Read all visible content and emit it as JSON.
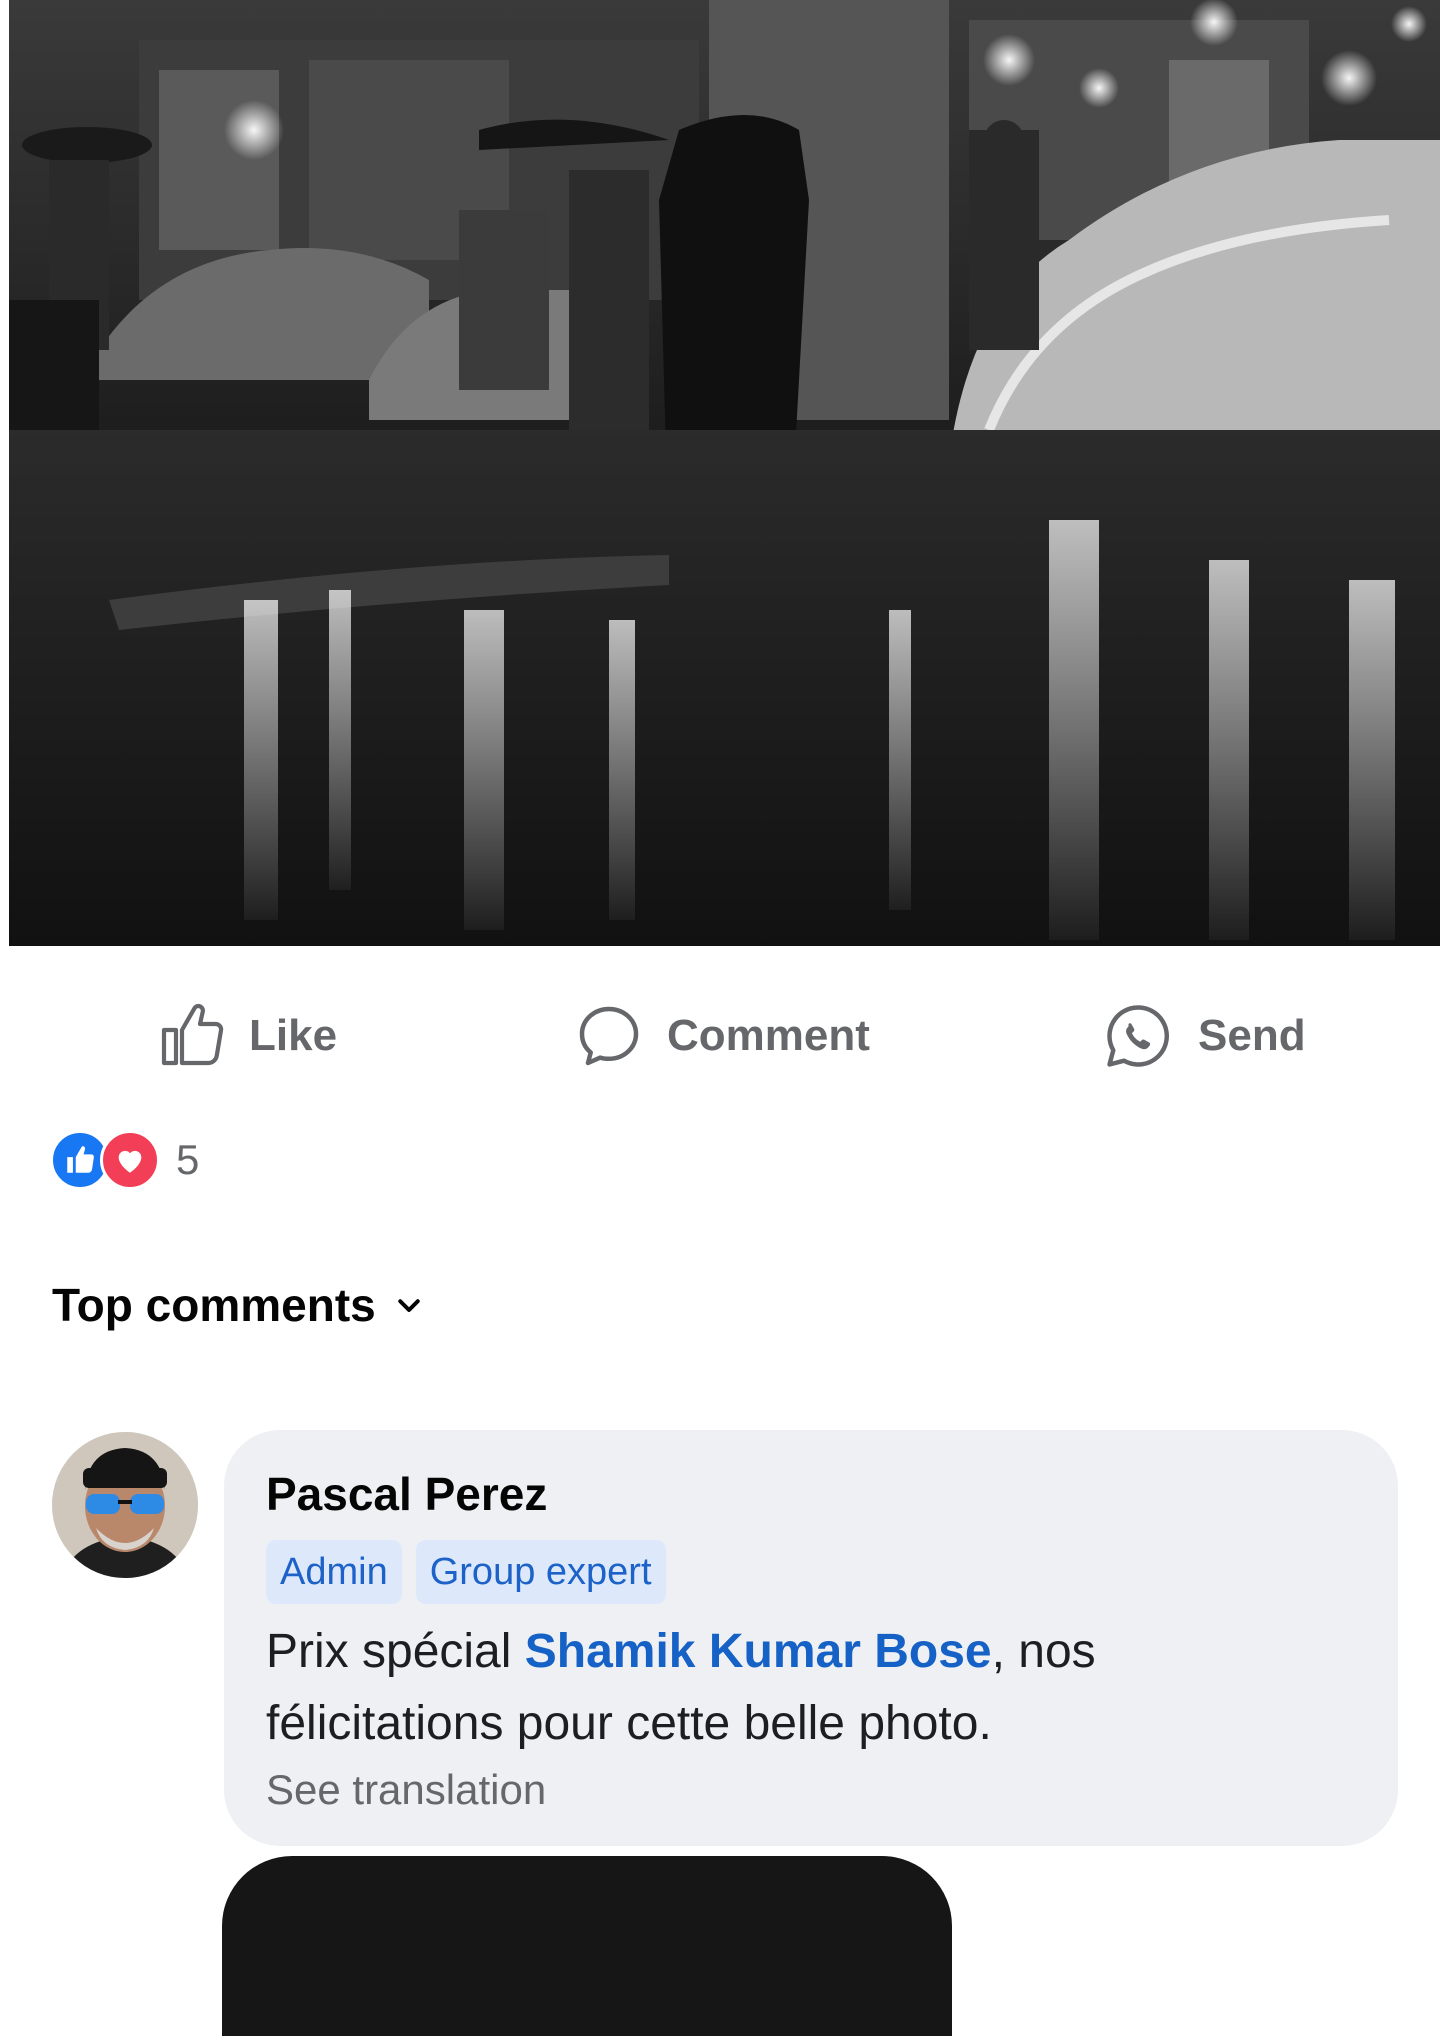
{
  "post": {
    "photo_alt": "Black and white photo of a rainy night market street"
  },
  "actions": {
    "like_label": "Like",
    "comment_label": "Comment",
    "send_label": "Send"
  },
  "reactions": {
    "count": "5",
    "types": [
      "like",
      "love"
    ]
  },
  "comments_sort": {
    "label": "Top comments"
  },
  "comment": {
    "author": "Pascal Perez",
    "badges": [
      "Admin",
      "Group expert"
    ],
    "text_before": "Prix spécial ",
    "mention": "Shamik Kumar Bose",
    "text_after": ", nos félicitations pour cette belle photo.",
    "see_translation": "See translation"
  },
  "colors": {
    "like_blue": "#1877f2",
    "love_red": "#f33e58",
    "mention_blue": "#1561c6",
    "bubble_bg": "#eef0f3"
  }
}
